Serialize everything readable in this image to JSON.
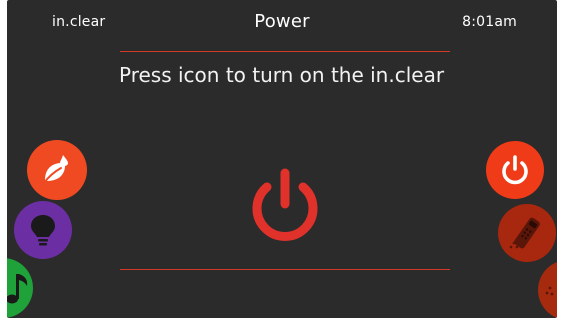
{
  "header": {
    "device_name": "in.clear",
    "title": "Power",
    "clock": "8:01am"
  },
  "main": {
    "instruction": "Press icon to turn on the in.clear",
    "power_icon": "power-icon"
  },
  "left_nav": [
    {
      "name": "leaf-drop-icon",
      "color": "#f04a22"
    },
    {
      "name": "lightbulb-icon",
      "color": "#6c2fa3"
    },
    {
      "name": "music-note-icon",
      "color": "#1fa23a"
    }
  ],
  "right_nav": [
    {
      "name": "power-icon",
      "color": "#f03b18"
    },
    {
      "name": "remote-control-icon",
      "color": "#a8270f"
    },
    {
      "name": "partial-icon",
      "color": "#a52a0e"
    }
  ],
  "colors": {
    "screen_bg": "#2b2b2b",
    "accent_red": "#e0312a",
    "divider": "#d23a28"
  }
}
